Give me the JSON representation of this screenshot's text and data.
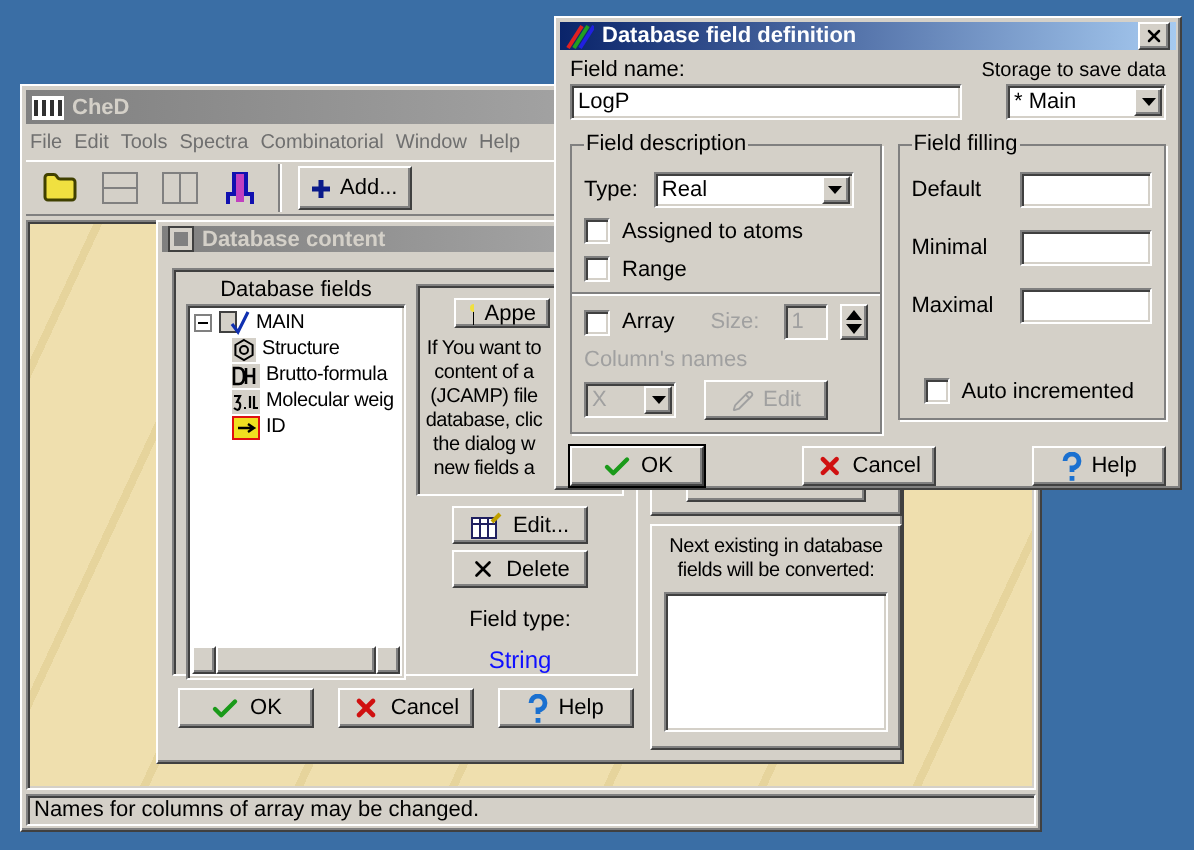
{
  "main_window": {
    "title": "CheD",
    "active": false,
    "menu": [
      "File",
      "Edit",
      "Tools",
      "Spectra",
      "Combinatorial",
      "Window",
      "Help"
    ],
    "add_button": "Add...",
    "status_bar": "Names for columns of array may be changed."
  },
  "content_dialog": {
    "title": "Database content",
    "active": false,
    "fields_label": "Database fields",
    "tree": [
      {
        "label": "MAIN",
        "kind": "root",
        "expanded": true,
        "children": [
          {
            "label": "Structure",
            "kind": "structure"
          },
          {
            "label": "Brutto-formula",
            "kind": "formula"
          },
          {
            "label": "Molecular weig",
            "kind": "number"
          },
          {
            "label": "ID",
            "kind": "id"
          }
        ]
      }
    ],
    "append_button": "Appe",
    "info_lines": [
      "If You want to",
      "content of a",
      "(JCAMP) file",
      "database, clic",
      "the dialog w",
      "new fields a"
    ],
    "edit_button": "Edit...",
    "delete_button": "Delete",
    "field_type_label": "Field type:",
    "field_type": "String",
    "convert_label": "Next existing in database fields will be converted:",
    "buttons": [
      {
        "label": "OK",
        "kind": "ok"
      },
      {
        "label": "Cancel",
        "kind": "cancel"
      },
      {
        "label": "Help",
        "kind": "help"
      }
    ]
  },
  "field_dialog": {
    "title": "Database field definition",
    "active": true,
    "field_name_label": "Field name:",
    "field_name": "LogP",
    "storage_label": "Storage to save data",
    "storage": "* Main",
    "description_title": "Field description",
    "type_label": "Type:",
    "type": "Real",
    "options": [
      {
        "label": "Assigned to atoms",
        "checked": false
      },
      {
        "label": "Range",
        "checked": false
      }
    ],
    "array": {
      "label": "Array",
      "checked": false
    },
    "size": {
      "label": "Size:",
      "value": "1",
      "disabled": true
    },
    "column_names": {
      "label": "Column's names",
      "value": "X",
      "disabled": true
    },
    "edit_button": {
      "label": "Edit",
      "disabled": true
    },
    "filling_title": "Field filling",
    "filling": [
      {
        "label": "Default"
      },
      {
        "label": "Minimal"
      },
      {
        "label": "Maximal"
      }
    ],
    "auto_increment": {
      "label": "Auto incremented",
      "checked": false
    },
    "buttons": [
      {
        "label": "OK",
        "kind": "ok",
        "default": true
      },
      {
        "label": "Cancel",
        "kind": "cancel",
        "default": false
      },
      {
        "label": "Help",
        "kind": "help",
        "default": false
      }
    ]
  }
}
